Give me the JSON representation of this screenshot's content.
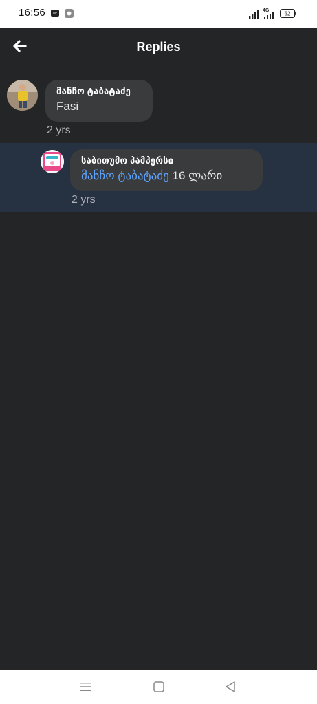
{
  "status_bar": {
    "time": "16:56",
    "network_label": "4G",
    "battery_level": "62"
  },
  "header": {
    "title": "Replies",
    "back_icon": "arrow-left-icon"
  },
  "comments": [
    {
      "author": "მანჩო ტაბატაძე",
      "text": "Fasi",
      "age": "2 yrs"
    },
    {
      "author": "საბითუმო პამპერსი",
      "mention": "მანჩო ტაბატაძე",
      "text": " 16 ლარი",
      "age": "2 yrs"
    }
  ],
  "nav_bar": {
    "icons": [
      "menu-icon",
      "home-square-icon",
      "back-triangle-icon"
    ]
  },
  "colors": {
    "background": "#242526",
    "bubble": "#3a3b3c",
    "highlight_row": "#263241",
    "mention": "#5ea4ff"
  }
}
